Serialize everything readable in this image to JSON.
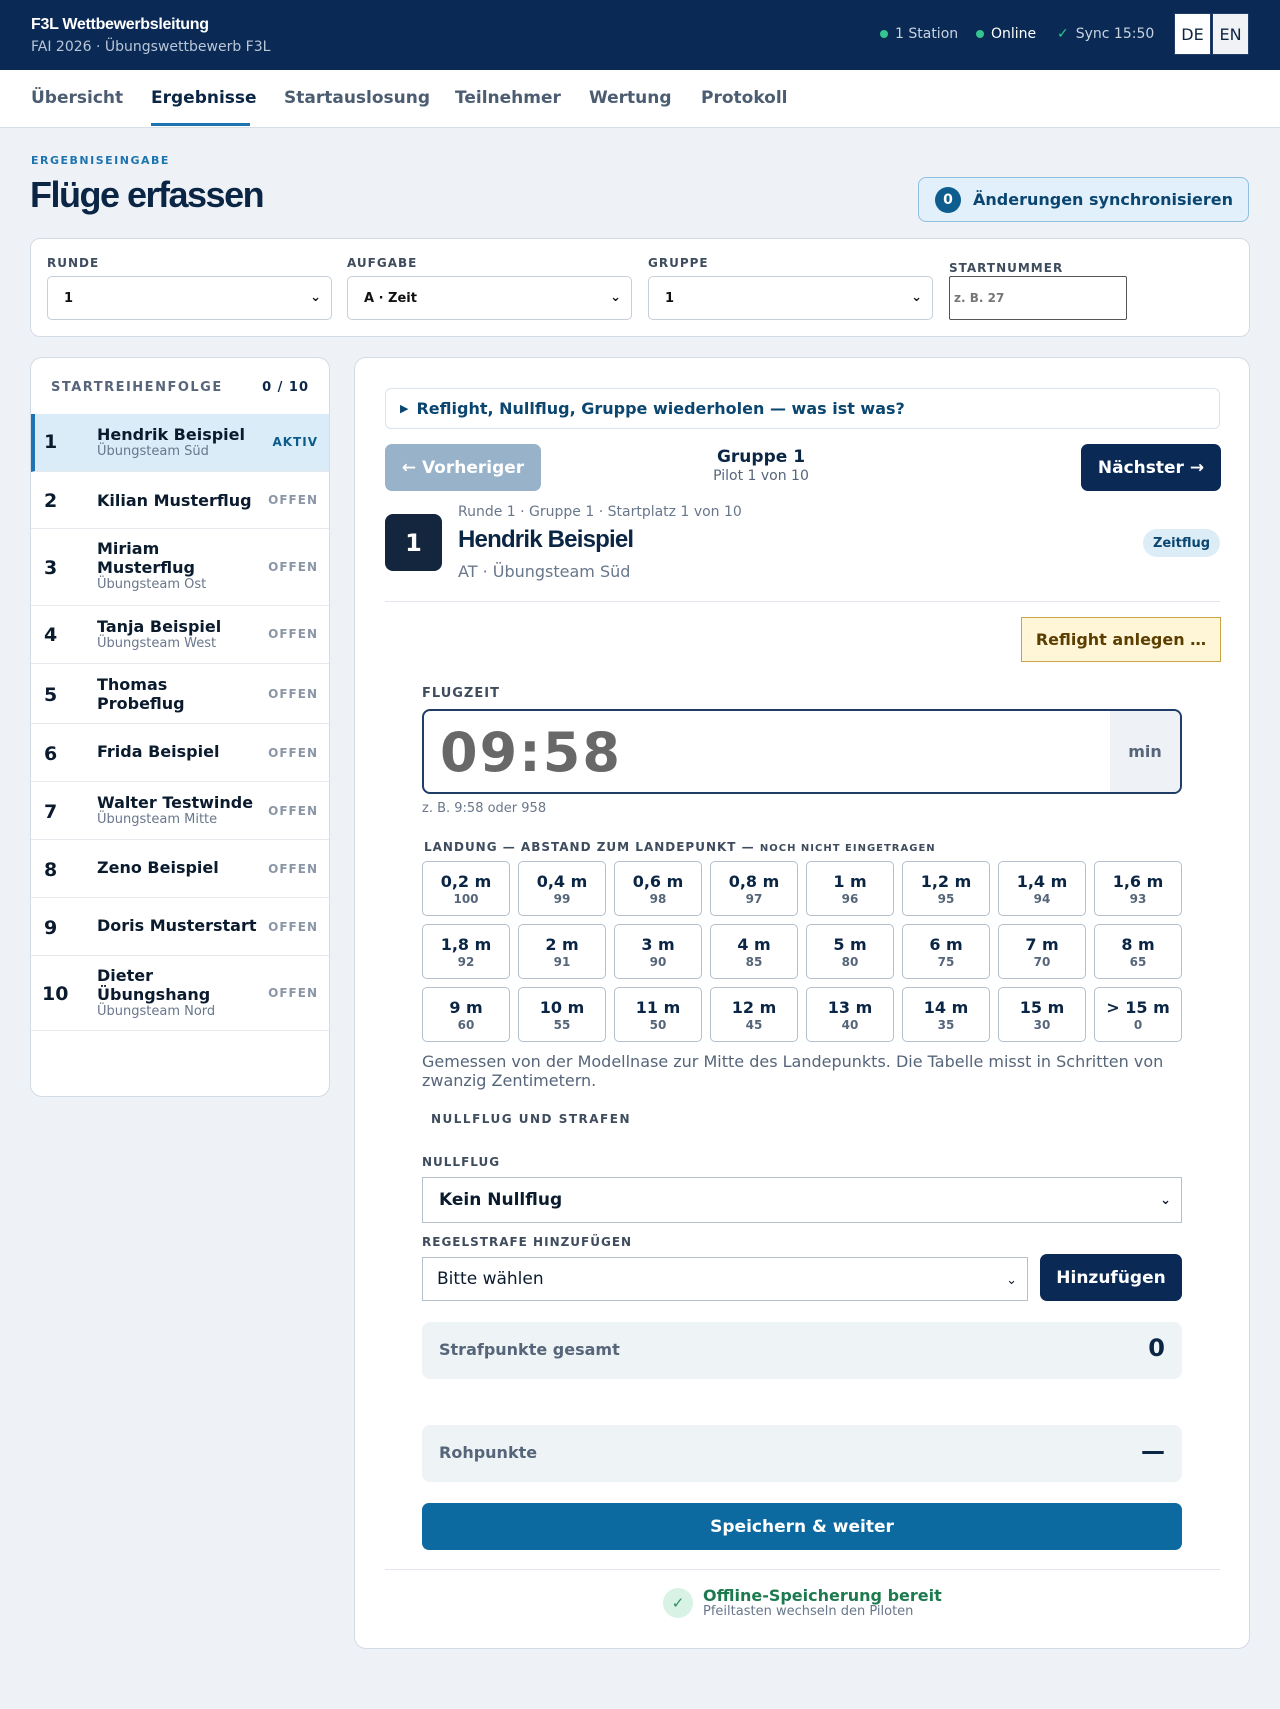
{
  "header": {
    "app_title": "F3L Wettbewerbsleitung",
    "app_subtitle": "FAI 2026 · Übungswettbewerb F3L",
    "station": "1 Station",
    "online": "Online",
    "sync": "Sync 15:50",
    "lang_de": "DE",
    "lang_en": "EN"
  },
  "nav": {
    "tabs": [
      {
        "label": "Übersicht"
      },
      {
        "label": "Ergebnisse"
      },
      {
        "label": "Startauslosung"
      },
      {
        "label": "Teilnehmer"
      },
      {
        "label": "Wertung"
      },
      {
        "label": "Protokoll"
      }
    ],
    "active_tab": "Ergebnisse"
  },
  "page": {
    "kicker": "ERGEBNISEINGABE",
    "title": "Flüge erfassen",
    "sync_count": "0",
    "sync_label": "Änderungen synchronisieren"
  },
  "filters": {
    "round_label": "RUNDE",
    "round_value": "1",
    "task_label": "AUFGABE",
    "task_value": "A · Zeit",
    "group_label": "GRUPPE",
    "group_value": "1",
    "start_label": "STARTNUMMER",
    "start_placeholder": "z. B. 27"
  },
  "sidebar": {
    "title": "STARTREIHENFOLGE",
    "count": "0 / 10",
    "pilots": [
      {
        "num": "1",
        "name": "Hendrik Beispiel",
        "team": "Übungsteam Süd",
        "status": "AKTIV"
      },
      {
        "num": "2",
        "name": "Kilian Musterflug",
        "team": "",
        "status": "OFFEN"
      },
      {
        "num": "3",
        "name": "Miriam Musterflug",
        "team": "Übungsteam Ost",
        "status": "OFFEN"
      },
      {
        "num": "4",
        "name": "Tanja Beispiel",
        "team": "Übungsteam West",
        "status": "OFFEN"
      },
      {
        "num": "5",
        "name": "Thomas Probeflug",
        "team": "",
        "status": "OFFEN"
      },
      {
        "num": "6",
        "name": "Frida Beispiel",
        "team": "",
        "status": "OFFEN"
      },
      {
        "num": "7",
        "name": "Walter Testwinde",
        "team": "Übungsteam Mitte",
        "status": "OFFEN"
      },
      {
        "num": "8",
        "name": "Zeno Beispiel",
        "team": "",
        "status": "OFFEN"
      },
      {
        "num": "9",
        "name": "Doris Musterstart",
        "team": "",
        "status": "OFFEN"
      },
      {
        "num": "10",
        "name": "Dieter Übungshang",
        "team": "Übungsteam Nord",
        "status": "OFFEN"
      }
    ]
  },
  "main": {
    "help_icon": "triangle-right-icon",
    "help_text": "Reflight, Nullflug, Gruppe wiederholen — was ist was?",
    "prev_label": "← Vorheriger",
    "next_label": "Nächster →",
    "group_title": "Gruppe 1",
    "group_sub": "Pilot 1 von 10",
    "pilot_num": "1",
    "pilot_meta": "Runde 1 · Gruppe 1 · Startplatz 1 von 10",
    "pilot_name": "Hendrik Beispiel",
    "pilot_origin": "AT · Übungsteam Süd",
    "task_badge": "Zeitflug",
    "reflight_label": "Reflight anlegen …",
    "flight_time_label": "FLUGZEIT",
    "flight_time_value": "09:58",
    "flight_time_unit": "min",
    "flight_time_hint": "z. B. 9:58 oder 958",
    "landing_label": "LANDUNG — ABSTAND ZUM LANDEPUNKT — ",
    "landing_status": "NOCH NICHT EINGETRAGEN",
    "landing_options": [
      {
        "d": "0,2 m",
        "p": "100"
      },
      {
        "d": "0,4 m",
        "p": "99"
      },
      {
        "d": "0,6 m",
        "p": "98"
      },
      {
        "d": "0,8 m",
        "p": "97"
      },
      {
        "d": "1 m",
        "p": "96"
      },
      {
        "d": "1,2 m",
        "p": "95"
      },
      {
        "d": "1,4 m",
        "p": "94"
      },
      {
        "d": "1,6 m",
        "p": "93"
      },
      {
        "d": "1,8 m",
        "p": "92"
      },
      {
        "d": "2 m",
        "p": "91"
      },
      {
        "d": "3 m",
        "p": "90"
      },
      {
        "d": "4 m",
        "p": "85"
      },
      {
        "d": "5 m",
        "p": "80"
      },
      {
        "d": "6 m",
        "p": "75"
      },
      {
        "d": "7 m",
        "p": "70"
      },
      {
        "d": "8 m",
        "p": "65"
      },
      {
        "d": "9 m",
        "p": "60"
      },
      {
        "d": "10 m",
        "p": "55"
      },
      {
        "d": "11 m",
        "p": "50"
      },
      {
        "d": "12 m",
        "p": "45"
      },
      {
        "d": "13 m",
        "p": "40"
      },
      {
        "d": "14 m",
        "p": "35"
      },
      {
        "d": "15 m",
        "p": "30"
      },
      {
        "d": "> 15 m",
        "p": "0"
      }
    ],
    "landing_note": "Gemessen von der Modellnase zur Mitte des Landepunkts. Die Tabelle misst in Schritten von zwanzig Zentimetern.",
    "penalty_section": "NULLFLUG UND STRAFEN",
    "nullflug_label": "NULLFLUG",
    "nullflug_value": "Kein Nullflug",
    "penalty_label": "REGELSTRAFE HINZUFÜGEN",
    "penalty_value": "Bitte wählen",
    "add_label": "Hinzufügen",
    "penalty_total_label": "Strafpunkte gesamt",
    "penalty_total_value": "0",
    "raw_label": "Rohpunkte",
    "raw_value": "—",
    "save_label": "Speichern & weiter",
    "offline_title": "Offline-Speicherung bereit",
    "offline_sub": "Pfeiltasten wechseln den Piloten"
  },
  "colors": {
    "header_bg": "#0a2a55",
    "accent": "#1d74b0",
    "save": "#0d6aa0",
    "online_dot": "#35c48f",
    "reflight_bg": "#fff6d8"
  }
}
